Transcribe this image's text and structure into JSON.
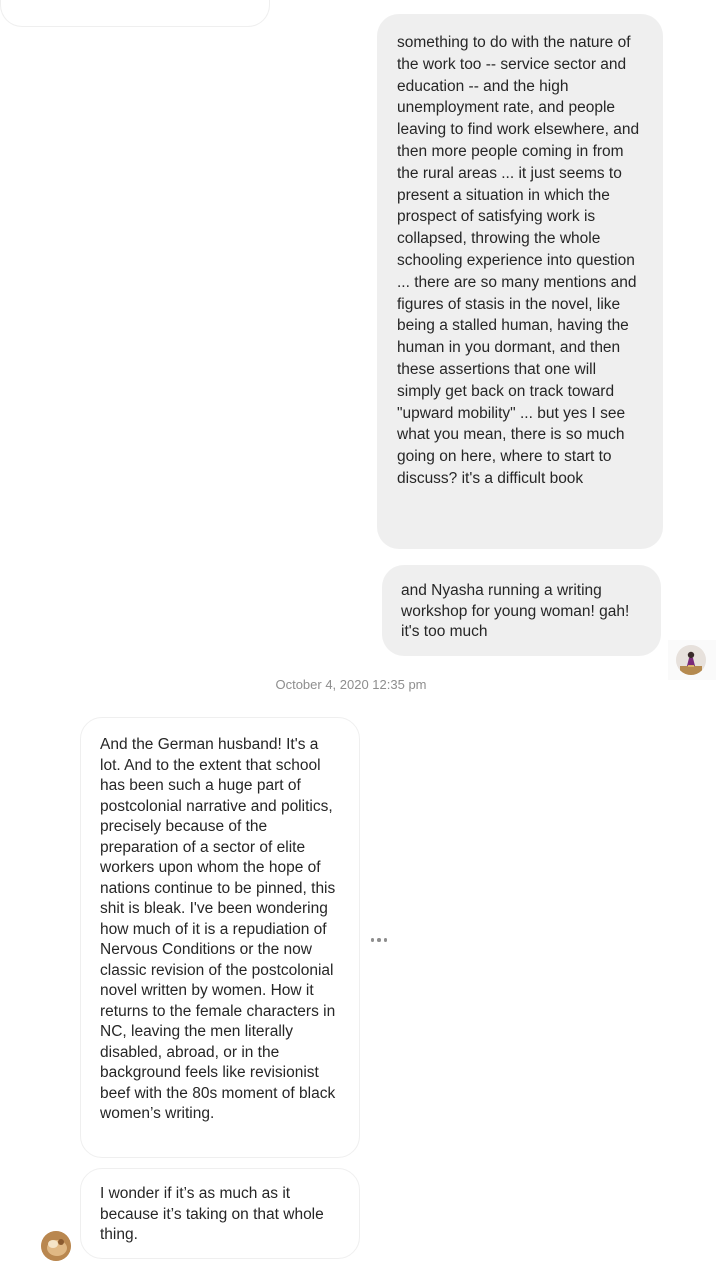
{
  "conversation": {
    "messages": [
      {
        "id": "sent-1",
        "direction": "sent",
        "text": "something to do with the nature of the work too -- service sector and education -- and the high unemployment rate, and people leaving to find work elsewhere, and then more people coming in from the rural areas ... it just seems to present a situation in which the prospect of satisfying work is collapsed, throwing the whole schooling experience into question ... there are so many mentions and figures of stasis in the novel, like being a stalled human, having the human in you dormant, and then these assertions that one will simply get back on track toward \"upward mobility\" ... but yes I see what you mean, there is so much going on here, where to start to discuss? it's a difficult book"
      },
      {
        "id": "sent-2",
        "direction": "sent",
        "text": "and Nyasha running a writing workshop for young woman! gah! it's too much"
      },
      {
        "id": "recv-1",
        "direction": "received",
        "text": "And the German husband! It's a lot. And to the extent that school has been such a huge part of postcolonial narrative and politics, precisely because of the preparation of a sector of elite workers upon whom the hope of nations continue to be pinned, this shit is bleak. I've been wondering how much of it is a repudiation of Nervous Conditions or the now classic revision of the postcolonial novel written by women. How it returns to the female characters in NC, leaving the men literally disabled, abroad, or in the background feels like revisionist beef with the 80s moment of black women’s writing."
      },
      {
        "id": "recv-2",
        "direction": "received",
        "text": "I wonder if it’s as much as it because it’s taking on that whole thing."
      }
    ],
    "timestamp": "October 4, 2020 12:35 pm",
    "icons": {
      "more_options": "more-horizontal-icon",
      "avatar_self": "user-avatar-self",
      "avatar_other": "user-avatar-other"
    },
    "colors": {
      "sent_bubble": "#efefef",
      "received_bubble_border": "#efefef",
      "text": "#262626",
      "timestamp": "#8e8e8e"
    }
  }
}
